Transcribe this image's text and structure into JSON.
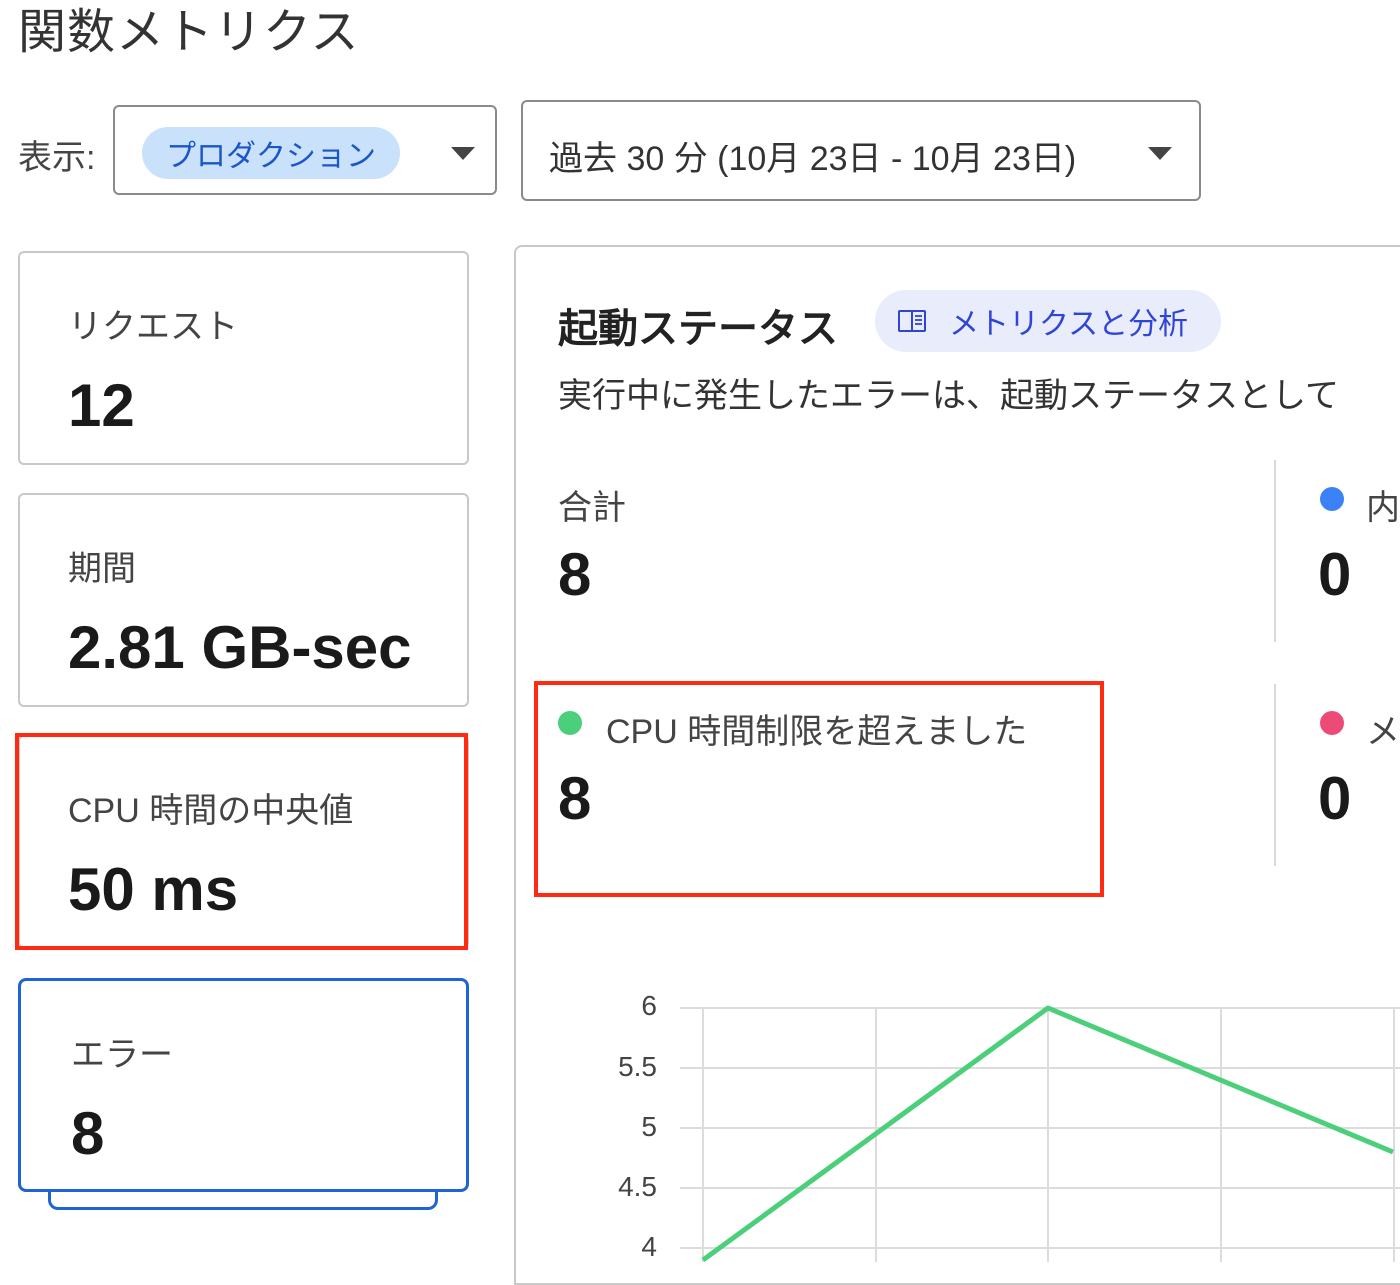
{
  "header": {
    "title": "関数メトリクス"
  },
  "filters": {
    "view_label": "表示:",
    "environment": "プロダクション",
    "time_range": "過去 30 分 (10月 23日 - 10月 23日)"
  },
  "cards": [
    {
      "label": "リクエスト",
      "value": "12"
    },
    {
      "label": "期間",
      "value": "2.81 GB-sec"
    },
    {
      "label": "CPU 時間の中央値",
      "value": "50 ms"
    },
    {
      "label": "エラー",
      "value": "8"
    }
  ],
  "panel": {
    "title": "起動ステータス",
    "docs_link": "メトリクスと分析",
    "description": "実行中に発生したエラーは、起動ステータスとして",
    "stats": [
      {
        "label": "合計",
        "value": "8"
      },
      {
        "label": "内",
        "value": "0",
        "dot_color": "#3b82f6"
      },
      {
        "label": "CPU 時間制限を超えました",
        "value": "8",
        "dot_color": "#4ccf7a"
      },
      {
        "label": "メ",
        "value": "0",
        "dot_color": "#ec4b77"
      }
    ]
  },
  "colors": {
    "accent": "#1f63d4",
    "highlight": "#ff2a12",
    "series": "#4ccf7a"
  },
  "chart_data": {
    "type": "line",
    "y_ticks": [
      "6",
      "5.5",
      "5",
      "4.5",
      "4"
    ],
    "ylim": [
      4,
      6
    ],
    "series": [
      {
        "x": [
          0.0,
          1.0,
          2.0
        ],
        "values": [
          3.9,
          6.0,
          4.8
        ]
      }
    ]
  }
}
